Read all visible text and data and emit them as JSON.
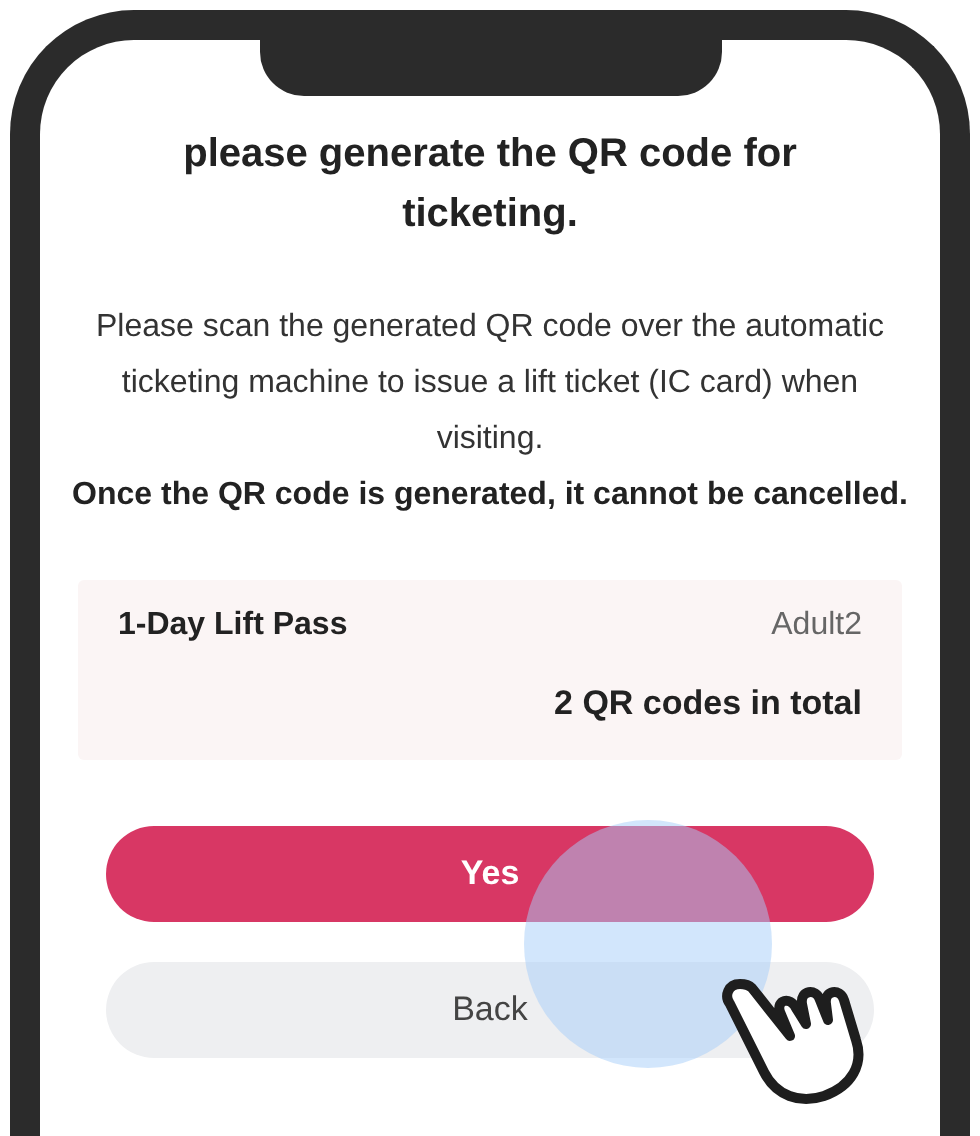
{
  "title": "please generate the QR code for ticketing.",
  "message": "Please scan the generated QR code over the automatic ticketing machine to issue a lift ticket (IC card) when visiting.",
  "warning": "Once the QR code is generated, it cannot be cancelled.",
  "summary": {
    "product": "1-Day Lift Pass",
    "ticket_type": "Adult2",
    "total": "2 QR codes in total"
  },
  "buttons": [
    {
      "label": "Yes",
      "kind": "primary"
    },
    {
      "label": "Back",
      "kind": "secondary"
    }
  ]
}
